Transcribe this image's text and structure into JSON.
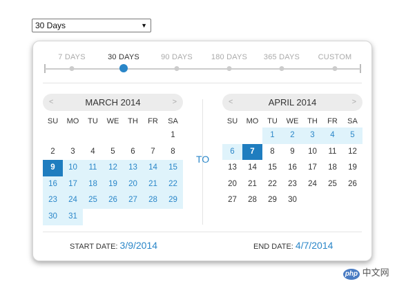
{
  "range_select": {
    "value": "30 Days",
    "arrow": "▼"
  },
  "presets": [
    {
      "label": "7 DAYS",
      "active": false
    },
    {
      "label": "30 DAYS",
      "active": true
    },
    {
      "label": "90 DAYS",
      "active": false
    },
    {
      "label": "180 DAYS",
      "active": false
    },
    {
      "label": "365 DAYS",
      "active": false
    },
    {
      "label": "CUSTOM",
      "active": false
    }
  ],
  "weekday_labels": [
    "SU",
    "MO",
    "TU",
    "WE",
    "TH",
    "FR",
    "SA"
  ],
  "nav": {
    "prev": "<",
    "next": ">"
  },
  "calendars": [
    {
      "month_label": "MARCH 2014",
      "first_weekday": 6,
      "days_in_month": 31,
      "selected_day": 9,
      "range_from": 9,
      "range_to": 31
    },
    {
      "month_label": "APRIL 2014",
      "first_weekday": 2,
      "days_in_month": 30,
      "selected_day": 7,
      "range_from": 1,
      "range_to": 7
    }
  ],
  "to_label": "TO",
  "start_date": {
    "label": "START DATE:",
    "value": "3/9/2014"
  },
  "end_date": {
    "label": "END DATE:",
    "value": "4/7/2014"
  },
  "watermark": {
    "badge": "php",
    "text": "中文网"
  },
  "colors": {
    "accent": "#2a86c8",
    "range_fill": "#dff3fb",
    "selected_fill": "#1f7dbf"
  }
}
